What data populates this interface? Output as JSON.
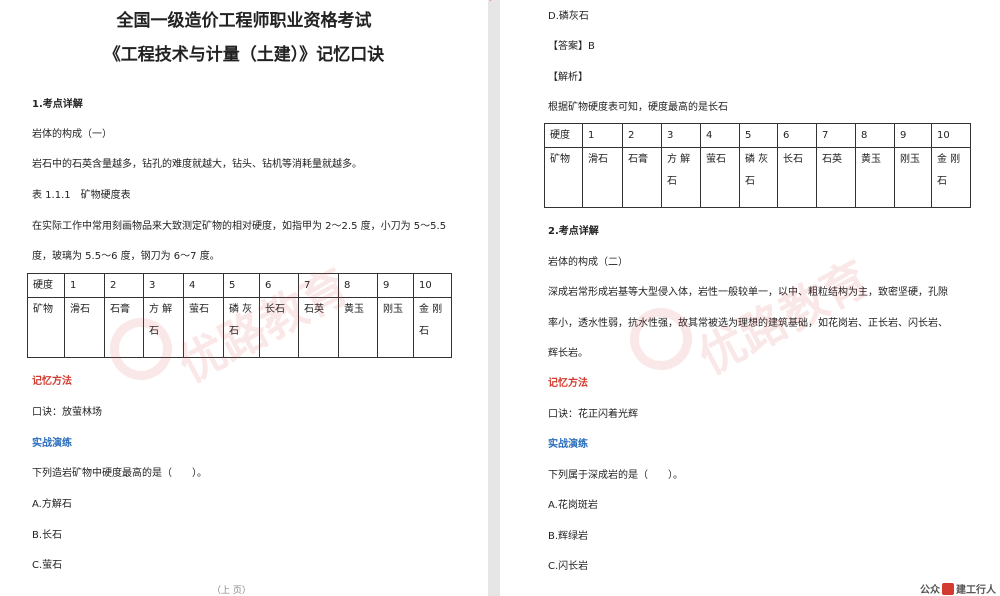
{
  "left": {
    "title1": "全国一级造价工程师职业资格考试",
    "title2": "《工程技术与计量（土建）》记忆口诀",
    "section1": "1.考点详解",
    "topic": "岩体的构成（一）",
    "para1": "岩石中的石英含量越多，钻孔的难度就越大，钻头、钻机等消耗量就越多。",
    "table_caption": "表 1.1.1　矿物硬度表",
    "para2_line1": "在实际工作中常用刻画物品来大致测定矿物的相对硬度，如指甲为 2～2.5 度，小刀为 5～5.5",
    "para2_line2": "度，玻璃为 5.5～6 度，钢刀为 6～7 度。",
    "memory_heading": "记忆方法",
    "mnemonic": "口诀：放萤林场",
    "practice_heading": "实战演练",
    "question": "下列造岩矿物中硬度最高的是（　　）。",
    "options": [
      "A.方解石",
      "B.长石",
      "C.萤石"
    ],
    "footer": "（上 页）"
  },
  "right": {
    "option_d": "D.磷灰石",
    "answer": "【答案】B",
    "analysis_label": "【解析】",
    "analysis": "根据矿物硬度表可知，硬度最高的是长石",
    "section2": "2.考点详解",
    "topic": "岩体的构成（二）",
    "para_line1": "深成岩常形成岩基等大型侵入体，岩性一般较单一，以中、粗粒结构为主，致密坚硬，孔隙",
    "para_line2": "率小，透水性弱，抗水性强，故其常被选为理想的建筑基础，如花岗岩、正长岩、闪长岩、",
    "para_line3": "辉长岩。",
    "memory_heading": "记忆方法",
    "mnemonic": "口诀：花正闪着光辉",
    "practice_heading": "实战演练",
    "question": "下列属于深成岩的是（　　）。",
    "options": [
      "A.花岗斑岩",
      "B.辉绿岩",
      "C.闪长岩"
    ],
    "wechat_tag_left": "公众",
    "wechat_tag_right": "建工行人"
  },
  "hardness_table": {
    "header_label": "硬度",
    "mineral_label": "矿物",
    "hardness": [
      "1",
      "2",
      "3",
      "4",
      "5",
      "6",
      "7",
      "8",
      "9",
      "10"
    ],
    "minerals": [
      [
        "滑石",
        ""
      ],
      [
        "石膏",
        ""
      ],
      [
        "方 解",
        "石"
      ],
      [
        "萤石",
        ""
      ],
      [
        "磷 灰",
        "石"
      ],
      [
        "长石",
        ""
      ],
      [
        "石英",
        ""
      ],
      [
        "黄玉",
        ""
      ],
      [
        "刚玉",
        ""
      ],
      [
        "金 刚",
        "石"
      ]
    ]
  },
  "watermark": "优路教育",
  "colors": {
    "accent_red": "#d23b2f",
    "heading_blue": "#2a6ebd"
  }
}
